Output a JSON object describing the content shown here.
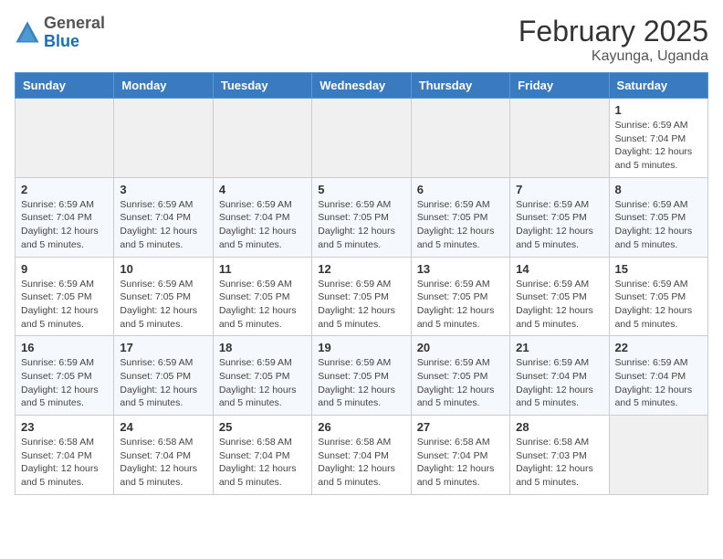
{
  "header": {
    "logo": {
      "general": "General",
      "blue": "Blue"
    },
    "title": "February 2025",
    "subtitle": "Kayunga, Uganda"
  },
  "weekdays": [
    "Sunday",
    "Monday",
    "Tuesday",
    "Wednesday",
    "Thursday",
    "Friday",
    "Saturday"
  ],
  "weeks": [
    [
      null,
      null,
      null,
      null,
      null,
      null,
      {
        "day": "1",
        "sunrise": "Sunrise: 6:59 AM",
        "sunset": "Sunset: 7:04 PM",
        "daylight": "Daylight: 12 hours and 5 minutes."
      }
    ],
    [
      {
        "day": "2",
        "sunrise": "Sunrise: 6:59 AM",
        "sunset": "Sunset: 7:04 PM",
        "daylight": "Daylight: 12 hours and 5 minutes."
      },
      {
        "day": "3",
        "sunrise": "Sunrise: 6:59 AM",
        "sunset": "Sunset: 7:04 PM",
        "daylight": "Daylight: 12 hours and 5 minutes."
      },
      {
        "day": "4",
        "sunrise": "Sunrise: 6:59 AM",
        "sunset": "Sunset: 7:04 PM",
        "daylight": "Daylight: 12 hours and 5 minutes."
      },
      {
        "day": "5",
        "sunrise": "Sunrise: 6:59 AM",
        "sunset": "Sunset: 7:05 PM",
        "daylight": "Daylight: 12 hours and 5 minutes."
      },
      {
        "day": "6",
        "sunrise": "Sunrise: 6:59 AM",
        "sunset": "Sunset: 7:05 PM",
        "daylight": "Daylight: 12 hours and 5 minutes."
      },
      {
        "day": "7",
        "sunrise": "Sunrise: 6:59 AM",
        "sunset": "Sunset: 7:05 PM",
        "daylight": "Daylight: 12 hours and 5 minutes."
      },
      {
        "day": "8",
        "sunrise": "Sunrise: 6:59 AM",
        "sunset": "Sunset: 7:05 PM",
        "daylight": "Daylight: 12 hours and 5 minutes."
      }
    ],
    [
      {
        "day": "9",
        "sunrise": "Sunrise: 6:59 AM",
        "sunset": "Sunset: 7:05 PM",
        "daylight": "Daylight: 12 hours and 5 minutes."
      },
      {
        "day": "10",
        "sunrise": "Sunrise: 6:59 AM",
        "sunset": "Sunset: 7:05 PM",
        "daylight": "Daylight: 12 hours and 5 minutes."
      },
      {
        "day": "11",
        "sunrise": "Sunrise: 6:59 AM",
        "sunset": "Sunset: 7:05 PM",
        "daylight": "Daylight: 12 hours and 5 minutes."
      },
      {
        "day": "12",
        "sunrise": "Sunrise: 6:59 AM",
        "sunset": "Sunset: 7:05 PM",
        "daylight": "Daylight: 12 hours and 5 minutes."
      },
      {
        "day": "13",
        "sunrise": "Sunrise: 6:59 AM",
        "sunset": "Sunset: 7:05 PM",
        "daylight": "Daylight: 12 hours and 5 minutes."
      },
      {
        "day": "14",
        "sunrise": "Sunrise: 6:59 AM",
        "sunset": "Sunset: 7:05 PM",
        "daylight": "Daylight: 12 hours and 5 minutes."
      },
      {
        "day": "15",
        "sunrise": "Sunrise: 6:59 AM",
        "sunset": "Sunset: 7:05 PM",
        "daylight": "Daylight: 12 hours and 5 minutes."
      }
    ],
    [
      {
        "day": "16",
        "sunrise": "Sunrise: 6:59 AM",
        "sunset": "Sunset: 7:05 PM",
        "daylight": "Daylight: 12 hours and 5 minutes."
      },
      {
        "day": "17",
        "sunrise": "Sunrise: 6:59 AM",
        "sunset": "Sunset: 7:05 PM",
        "daylight": "Daylight: 12 hours and 5 minutes."
      },
      {
        "day": "18",
        "sunrise": "Sunrise: 6:59 AM",
        "sunset": "Sunset: 7:05 PM",
        "daylight": "Daylight: 12 hours and 5 minutes."
      },
      {
        "day": "19",
        "sunrise": "Sunrise: 6:59 AM",
        "sunset": "Sunset: 7:05 PM",
        "daylight": "Daylight: 12 hours and 5 minutes."
      },
      {
        "day": "20",
        "sunrise": "Sunrise: 6:59 AM",
        "sunset": "Sunset: 7:05 PM",
        "daylight": "Daylight: 12 hours and 5 minutes."
      },
      {
        "day": "21",
        "sunrise": "Sunrise: 6:59 AM",
        "sunset": "Sunset: 7:04 PM",
        "daylight": "Daylight: 12 hours and 5 minutes."
      },
      {
        "day": "22",
        "sunrise": "Sunrise: 6:59 AM",
        "sunset": "Sunset: 7:04 PM",
        "daylight": "Daylight: 12 hours and 5 minutes."
      }
    ],
    [
      {
        "day": "23",
        "sunrise": "Sunrise: 6:58 AM",
        "sunset": "Sunset: 7:04 PM",
        "daylight": "Daylight: 12 hours and 5 minutes."
      },
      {
        "day": "24",
        "sunrise": "Sunrise: 6:58 AM",
        "sunset": "Sunset: 7:04 PM",
        "daylight": "Daylight: 12 hours and 5 minutes."
      },
      {
        "day": "25",
        "sunrise": "Sunrise: 6:58 AM",
        "sunset": "Sunset: 7:04 PM",
        "daylight": "Daylight: 12 hours and 5 minutes."
      },
      {
        "day": "26",
        "sunrise": "Sunrise: 6:58 AM",
        "sunset": "Sunset: 7:04 PM",
        "daylight": "Daylight: 12 hours and 5 minutes."
      },
      {
        "day": "27",
        "sunrise": "Sunrise: 6:58 AM",
        "sunset": "Sunset: 7:04 PM",
        "daylight": "Daylight: 12 hours and 5 minutes."
      },
      {
        "day": "28",
        "sunrise": "Sunrise: 6:58 AM",
        "sunset": "Sunset: 7:03 PM",
        "daylight": "Daylight: 12 hours and 5 minutes."
      },
      null
    ]
  ]
}
